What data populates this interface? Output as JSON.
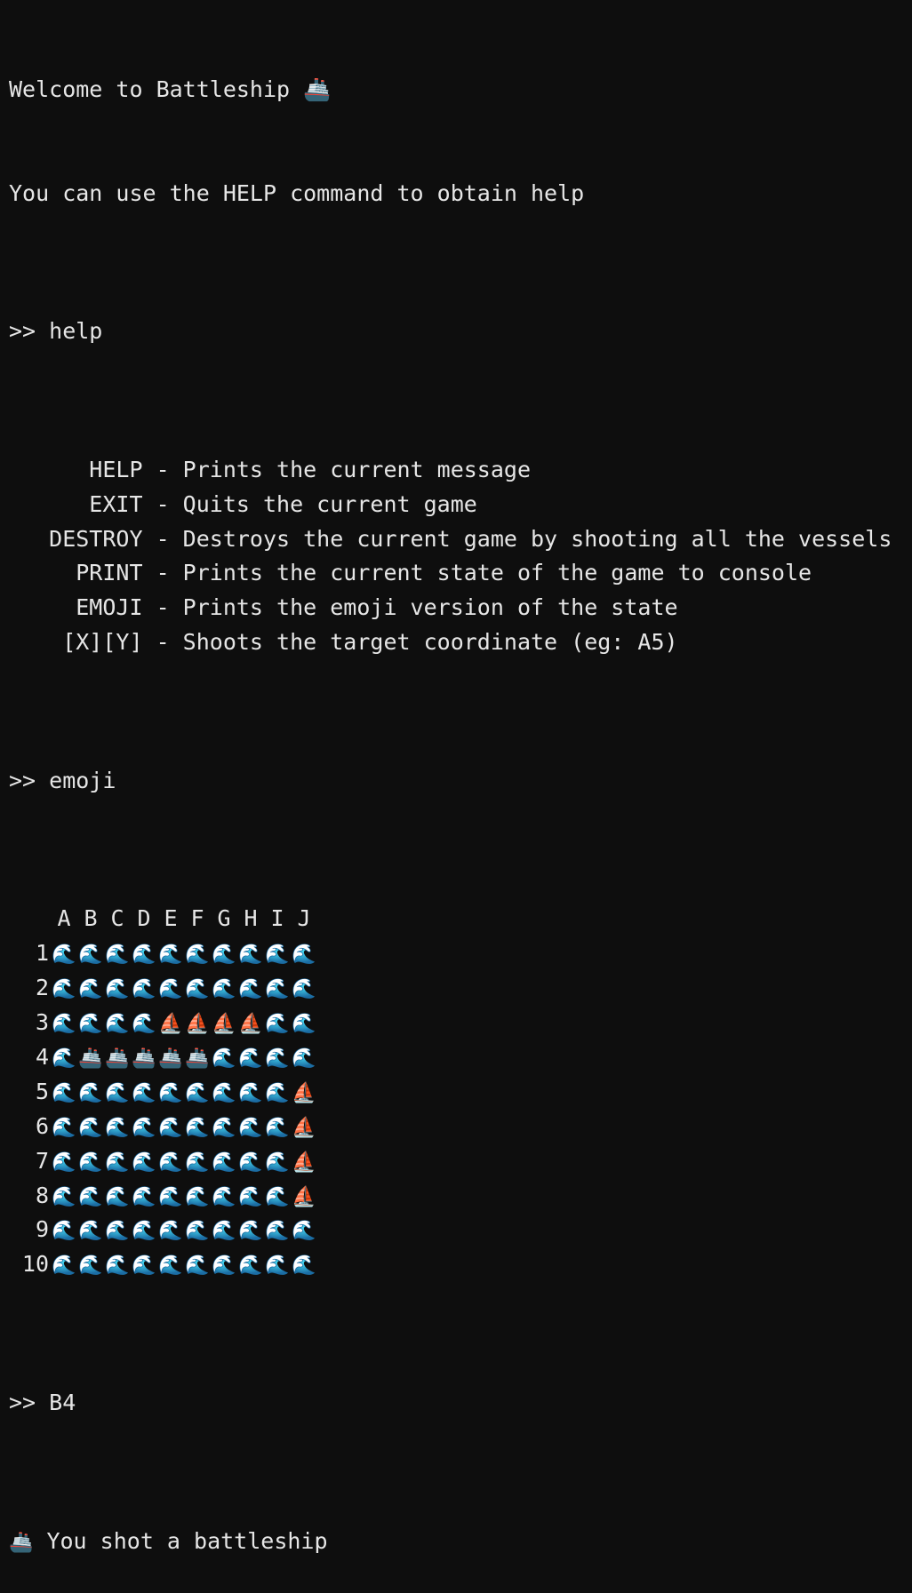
{
  "intro": {
    "welcome": "Welcome to Battleship 🚢",
    "help_hint": "You can use the HELP command to obtain help"
  },
  "commands": [
    {
      "prompt": ">> ",
      "input": "help"
    },
    {
      "prompt": ">> ",
      "input": "emoji"
    },
    {
      "prompt": ">> ",
      "input": "B4"
    }
  ],
  "help_output": [
    {
      "name": "      HELP",
      "desc": " - Prints the current message"
    },
    {
      "name": "      EXIT",
      "desc": " - Quits the current game"
    },
    {
      "name": "   DESTROY",
      "desc": " - Destroys the current game by shooting all the vessels"
    },
    {
      "name": "     PRINT",
      "desc": " - Prints the current state of the game to console"
    },
    {
      "name": "     EMOJI",
      "desc": " - Prints the emoji version of the state"
    },
    {
      "name": "    [X][Y]",
      "desc": " - Shoots the target coordinate (eg: A5)"
    }
  ],
  "board": {
    "columns": [
      "A",
      "B",
      "C",
      "D",
      "E",
      "F",
      "G",
      "H",
      "I",
      "J"
    ],
    "rows": [
      {
        "label": "1",
        "cells": [
          "🌊",
          "🌊",
          "🌊",
          "🌊",
          "🌊",
          "🌊",
          "🌊",
          "🌊",
          "🌊",
          "🌊"
        ]
      },
      {
        "label": "2",
        "cells": [
          "🌊",
          "🌊",
          "🌊",
          "🌊",
          "🌊",
          "🌊",
          "🌊",
          "🌊",
          "🌊",
          "🌊"
        ]
      },
      {
        "label": "3",
        "cells": [
          "🌊",
          "🌊",
          "🌊",
          "🌊",
          "⛵",
          "⛵",
          "⛵",
          "⛵",
          "🌊",
          "🌊"
        ]
      },
      {
        "label": "4",
        "cells": [
          "🌊",
          "🚢",
          "🚢",
          "🚢",
          "🚢",
          "🚢",
          "🌊",
          "🌊",
          "🌊",
          "🌊"
        ]
      },
      {
        "label": "5",
        "cells": [
          "🌊",
          "🌊",
          "🌊",
          "🌊",
          "🌊",
          "🌊",
          "🌊",
          "🌊",
          "🌊",
          "⛵"
        ]
      },
      {
        "label": "6",
        "cells": [
          "🌊",
          "🌊",
          "🌊",
          "🌊",
          "🌊",
          "🌊",
          "🌊",
          "🌊",
          "🌊",
          "⛵"
        ]
      },
      {
        "label": "7",
        "cells": [
          "🌊",
          "🌊",
          "🌊",
          "🌊",
          "🌊",
          "🌊",
          "🌊",
          "🌊",
          "🌊",
          "⛵"
        ]
      },
      {
        "label": "8",
        "cells": [
          "🌊",
          "🌊",
          "🌊",
          "🌊",
          "🌊",
          "🌊",
          "🌊",
          "🌊",
          "🌊",
          "⛵"
        ]
      },
      {
        "label": "9",
        "cells": [
          "🌊",
          "🌊",
          "🌊",
          "🌊",
          "🌊",
          "🌊",
          "🌊",
          "🌊",
          "🌊",
          "🌊"
        ]
      },
      {
        "label": "10",
        "cells": [
          "🌊",
          "🌊",
          "🌊",
          "🌊",
          "🌊",
          "🌊",
          "🌊",
          "🌊",
          "🌊",
          "🌊"
        ]
      }
    ]
  },
  "result": {
    "icon": "🚢",
    "message": " You shot a battleship"
  }
}
